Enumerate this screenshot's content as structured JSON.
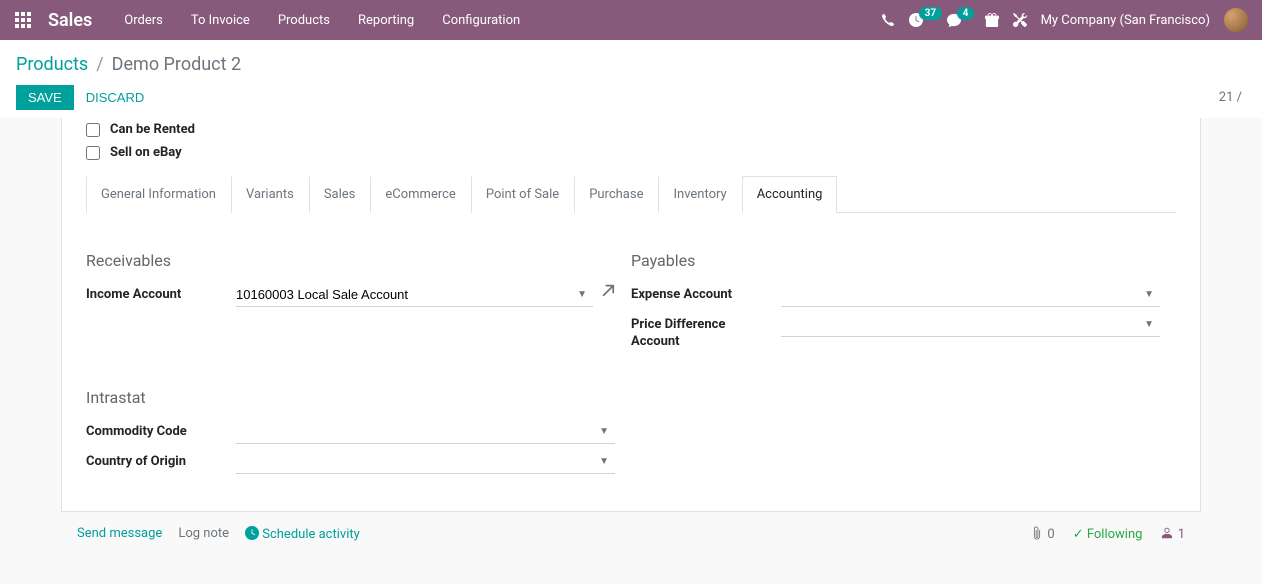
{
  "topbar": {
    "brand": "Sales",
    "menu": [
      "Orders",
      "To Invoice",
      "Products",
      "Reporting",
      "Configuration"
    ],
    "activity_count": "37",
    "message_count": "4",
    "company": "My Company (San Francisco)"
  },
  "breadcrumb": {
    "parent": "Products",
    "current": "Demo Product 2"
  },
  "buttons": {
    "save": "Save",
    "discard": "Discard"
  },
  "pager": {
    "text": "21 /"
  },
  "checkboxes": {
    "can_be_rented": "Can be Rented",
    "sell_on_ebay": "Sell on eBay"
  },
  "tabs": [
    "General Information",
    "Variants",
    "Sales",
    "eCommerce",
    "Point of Sale",
    "Purchase",
    "Inventory",
    "Accounting"
  ],
  "active_tab_index": 7,
  "sections": {
    "receivables": {
      "title": "Receivables",
      "income_account_label": "Income Account",
      "income_account_value": "10160003 Local Sale Account"
    },
    "payables": {
      "title": "Payables",
      "expense_account_label": "Expense Account",
      "expense_account_value": "",
      "price_diff_label": "Price Difference Account",
      "price_diff_value": ""
    },
    "intrastat": {
      "title": "Intrastat",
      "commodity_label": "Commodity Code",
      "commodity_value": "",
      "country_label": "Country of Origin",
      "country_value": ""
    }
  },
  "chatter": {
    "send_message": "Send message",
    "log_note": "Log note",
    "schedule": "Schedule activity",
    "attachments": "0",
    "following": "Following",
    "followers": "1"
  }
}
